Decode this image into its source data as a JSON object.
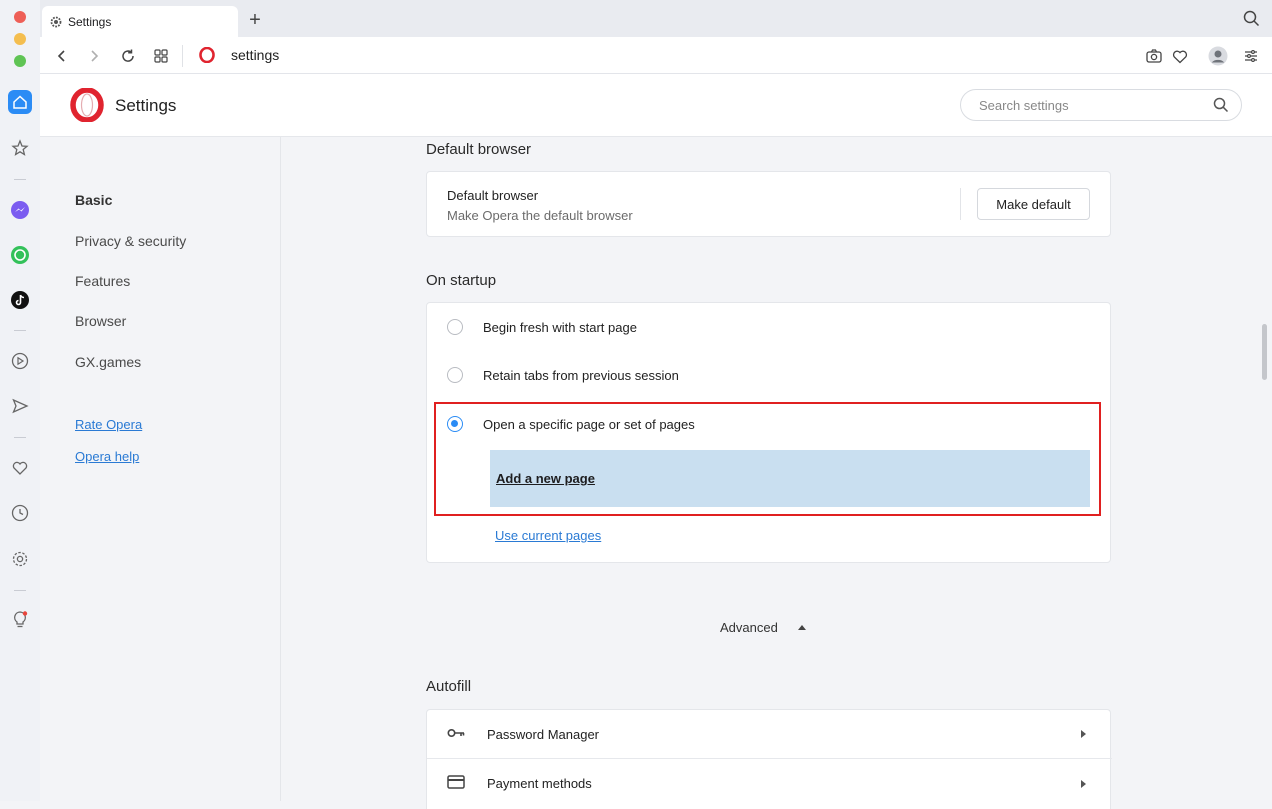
{
  "tab": {
    "title": "Settings"
  },
  "address": {
    "url": "settings"
  },
  "header": {
    "title": "Settings",
    "search_placeholder": "Search settings"
  },
  "nav": {
    "items": [
      "Basic",
      "Privacy & security",
      "Features",
      "Browser",
      "GX.games"
    ],
    "active": "Basic",
    "links": [
      "Rate Opera",
      "Opera help"
    ]
  },
  "default_browser": {
    "section_title": "Default browser",
    "title": "Default browser",
    "subtitle": "Make Opera the default browser",
    "button": "Make default"
  },
  "startup": {
    "section_title": "On startup",
    "options": [
      "Begin fresh with start page",
      "Retain tabs from previous session",
      "Open a specific page or set of pages"
    ],
    "selected": "Open a specific page or set of pages",
    "add_page": "Add a new page",
    "use_current": "Use current pages"
  },
  "advanced": {
    "label": "Advanced"
  },
  "autofill": {
    "section_title": "Autofill",
    "items": [
      {
        "label": "Password Manager",
        "icon": "key-icon"
      },
      {
        "label": "Payment methods",
        "icon": "credit-card-icon"
      }
    ]
  },
  "colors": {
    "accent": "#2b8cf5",
    "highlight_border": "#e02020",
    "selected_bg": "#c9dff0",
    "link": "#2a7ad4"
  }
}
